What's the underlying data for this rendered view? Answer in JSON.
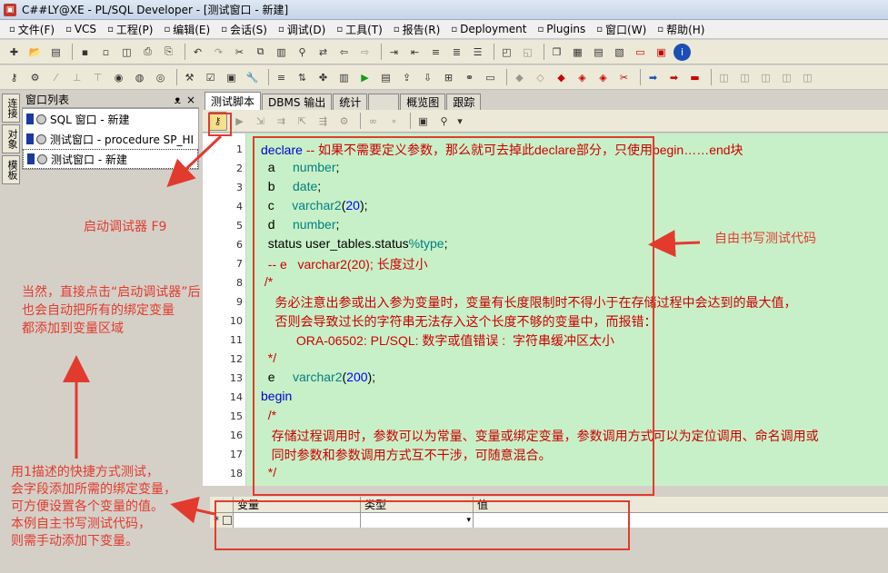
{
  "window": {
    "title": "C##LY@XE - PL/SQL Developer - [测试窗口 - 新建]"
  },
  "menu": [
    {
      "label": "文件(F)"
    },
    {
      "label": "VCS"
    },
    {
      "label": "工程(P)"
    },
    {
      "label": "编辑(E)"
    },
    {
      "label": "会话(S)"
    },
    {
      "label": "调试(D)"
    },
    {
      "label": "工具(T)"
    },
    {
      "label": "报告(R)"
    },
    {
      "label": "Deployment"
    },
    {
      "label": "Plugins"
    },
    {
      "label": "窗口(W)"
    },
    {
      "label": "帮助(H)"
    }
  ],
  "side_tabs": [
    "连接",
    "对象",
    "模板"
  ],
  "window_list": {
    "header": "窗口列表",
    "pin": "ᴥ",
    "close": "×",
    "items": [
      {
        "label": "SQL 窗口 - 新建"
      },
      {
        "label": "测试窗口 - procedure SP_HI"
      },
      {
        "label": "测试窗口 - 新建"
      }
    ]
  },
  "tabs": [
    "测试脚本",
    "DBMS 输出",
    "统计",
    "",
    "概览图",
    "跟踪"
  ],
  "code_lines": [
    {
      "n": "1",
      "parts": [
        {
          "c": "kw",
          "t": "declare "
        },
        {
          "c": "cm",
          "t": "-- 如果不需要定义参数，那么就可去掉此declare部分，只使用begin……end块"
        }
      ]
    },
    {
      "n": "2",
      "parts": [
        {
          "c": "tx",
          "t": "  a     "
        },
        {
          "c": "ty",
          "t": "number"
        },
        {
          "c": "tx",
          "t": ";"
        }
      ]
    },
    {
      "n": "3",
      "parts": [
        {
          "c": "tx",
          "t": "  b     "
        },
        {
          "c": "ty",
          "t": "date"
        },
        {
          "c": "tx",
          "t": ";"
        }
      ]
    },
    {
      "n": "4",
      "parts": [
        {
          "c": "tx",
          "t": "  c     "
        },
        {
          "c": "ty",
          "t": "varchar2"
        },
        {
          "c": "tx",
          "t": "("
        },
        {
          "c": "nm",
          "t": "20"
        },
        {
          "c": "tx",
          "t": ");"
        }
      ]
    },
    {
      "n": "5",
      "parts": [
        {
          "c": "tx",
          "t": "  d     "
        },
        {
          "c": "ty",
          "t": "number"
        },
        {
          "c": "tx",
          "t": ";"
        }
      ]
    },
    {
      "n": "6",
      "parts": [
        {
          "c": "tx",
          "t": "  status user_tables.status"
        },
        {
          "c": "ty",
          "t": "%type"
        },
        {
          "c": "tx",
          "t": ";"
        }
      ]
    },
    {
      "n": "7",
      "parts": [
        {
          "c": "cm",
          "t": "  -- e   varchar2(20); 长度过小"
        }
      ]
    },
    {
      "n": "8",
      "parts": [
        {
          "c": "cm",
          "t": " /*"
        }
      ]
    },
    {
      "n": "9",
      "parts": [
        {
          "c": "cm",
          "t": "    务必注意出参或出入参为变量时，变量有长度限制时不得小于在存储过程中会达到的最大值，"
        }
      ]
    },
    {
      "n": "10",
      "parts": [
        {
          "c": "cm",
          "t": "    否则会导致过长的字符串无法存入这个长度不够的变量中，而报错："
        }
      ]
    },
    {
      "n": "11",
      "parts": [
        {
          "c": "cm",
          "t": "          ORA-06502: PL/SQL: 数字或值错误 :  字符串缓冲区太小"
        }
      ]
    },
    {
      "n": "12",
      "parts": [
        {
          "c": "cm",
          "t": "  */"
        }
      ]
    },
    {
      "n": "13",
      "parts": [
        {
          "c": "tx",
          "t": "  e     "
        },
        {
          "c": "ty",
          "t": "varchar2"
        },
        {
          "c": "tx",
          "t": "("
        },
        {
          "c": "nm",
          "t": "200"
        },
        {
          "c": "tx",
          "t": ");"
        }
      ]
    },
    {
      "n": "14",
      "parts": [
        {
          "c": "kw",
          "t": "begin"
        }
      ]
    },
    {
      "n": "15",
      "parts": [
        {
          "c": "cm",
          "t": "  /*"
        }
      ]
    },
    {
      "n": "16",
      "parts": [
        {
          "c": "cm",
          "t": "   存储过程调用时，参数可以为常量、变量或绑定变量，参数调用方式可以为定位调用、命名调用或"
        }
      ]
    },
    {
      "n": "17",
      "parts": [
        {
          "c": "cm",
          "t": "   同时参数和参数调用方式互不干涉，可随意混合。"
        }
      ]
    },
    {
      "n": "18",
      "parts": [
        {
          "c": "cm",
          "t": "  */"
        }
      ]
    }
  ],
  "var_grid": {
    "headers": [
      "",
      "变量",
      "类型",
      "值"
    ],
    "row_marker": "*"
  },
  "annotations": {
    "debugger": "启动调试器 F9",
    "free_code": "自由书写测试代码",
    "note1": [
      "当然，直接点击“启动调试器”后",
      "也会自动把所有的绑定变量",
      "都添加到变量区域"
    ],
    "note2": [
      "用1描述的快捷方式测试，",
      "会字段添加所需的绑定变量，",
      "可方便设置各个变量的值。",
      "本例自主书写测试代码，",
      "则需手动添加下变量。"
    ]
  }
}
